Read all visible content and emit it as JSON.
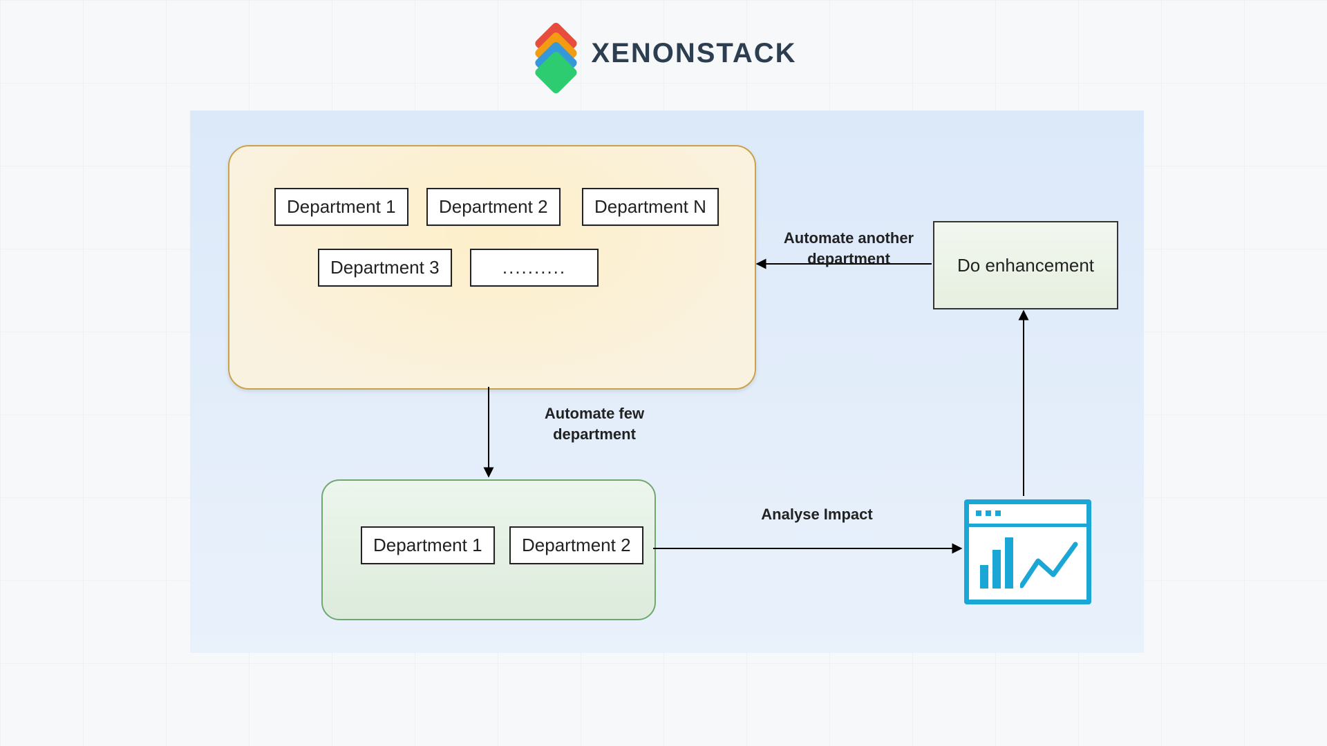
{
  "brand": {
    "name": "XENONSTACK"
  },
  "departments_pool": {
    "items": [
      "Department 1",
      "Department 2",
      "Department N",
      "Department 3",
      ".........."
    ]
  },
  "automated_pool": {
    "items": [
      "Department 1",
      "Department 2"
    ]
  },
  "enhancement_box": {
    "label": "Do enhancement"
  },
  "edges": {
    "automate_few": "Automate few department",
    "analyse_impact": "Analyse Impact",
    "automate_another": "Automate another department"
  }
}
